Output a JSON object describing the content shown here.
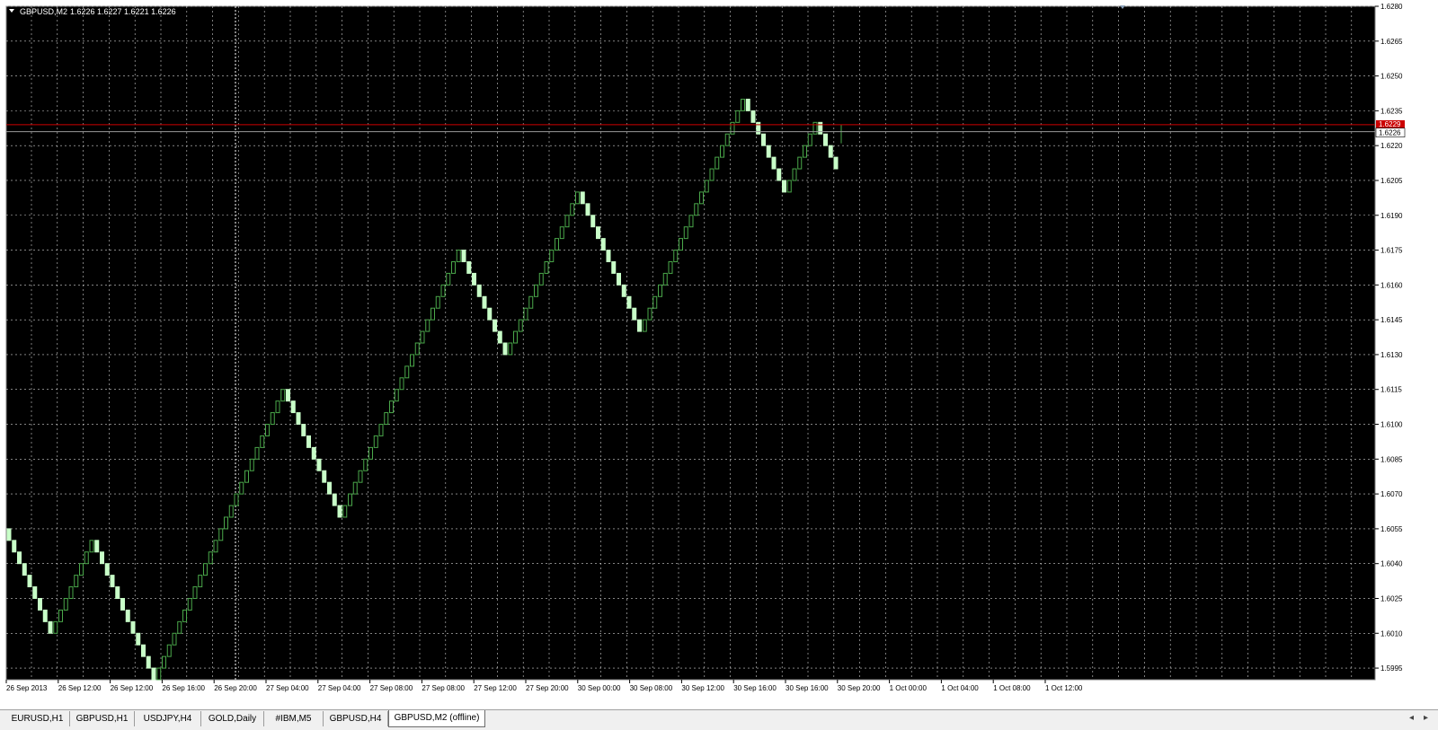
{
  "chart_info": {
    "symbol_label": "GBPUSD,M2",
    "ohlc_label": "1.6226 1.6227 1.6221 1.6226"
  },
  "colors": {
    "background": "#000000",
    "grid": "#cfcfcf",
    "bar_up": "#4aa84a",
    "bar_down_fill": "#c8ffc8",
    "bid_line": "#cc0000",
    "ask_line": "#9a9a9a"
  },
  "chart_data": {
    "type": "renko",
    "box_size": 0.0005,
    "start_price": 1.6055,
    "ylim": [
      1.599,
      1.628
    ],
    "price_ticks": [
      "1.6280",
      "1.6265",
      "1.6250",
      "1.6235",
      "1.6220",
      "1.6205",
      "1.6190",
      "1.6175",
      "1.6160",
      "1.6145",
      "1.6130",
      "1.6115",
      "1.6100",
      "1.6085",
      "1.6070",
      "1.6055",
      "1.6040",
      "1.6025",
      "1.6010",
      "1.5995"
    ],
    "time_ticks": [
      "26 Sep 2013",
      "26 Sep 12:00",
      "26 Sep 12:00",
      "26 Sep 16:00",
      "26 Sep 20:00",
      "27 Sep 04:00",
      "27 Sep 04:00",
      "27 Sep 08:00",
      "27 Sep 08:00",
      "27 Sep 12:00",
      "27 Sep 20:00",
      "30 Sep 00:00",
      "30 Sep 08:00",
      "30 Sep 12:00",
      "30 Sep 16:00",
      "30 Sep 16:00",
      "30 Sep 20:00",
      "1 Oct 00:00",
      "1 Oct 04:00",
      "1 Oct 08:00",
      "1 Oct 12:00"
    ],
    "moves": [
      -9,
      8,
      -12,
      25,
      -11,
      23,
      -9,
      14,
      -12,
      20,
      -8,
      6,
      -4
    ],
    "bid_price": "1.6229",
    "current_price": "1.6226",
    "grid": true
  },
  "tabs": [
    {
      "label": "EURUSD,H1",
      "active": false
    },
    {
      "label": "GBPUSD,H1",
      "active": false
    },
    {
      "label": "USDJPY,H4",
      "active": false
    },
    {
      "label": "GOLD,Daily",
      "active": false
    },
    {
      "label": "#IBM,M5",
      "active": false
    },
    {
      "label": "GBPUSD,H4",
      "active": false
    },
    {
      "label": "GBPUSD,M2 (offline)",
      "active": true
    }
  ]
}
